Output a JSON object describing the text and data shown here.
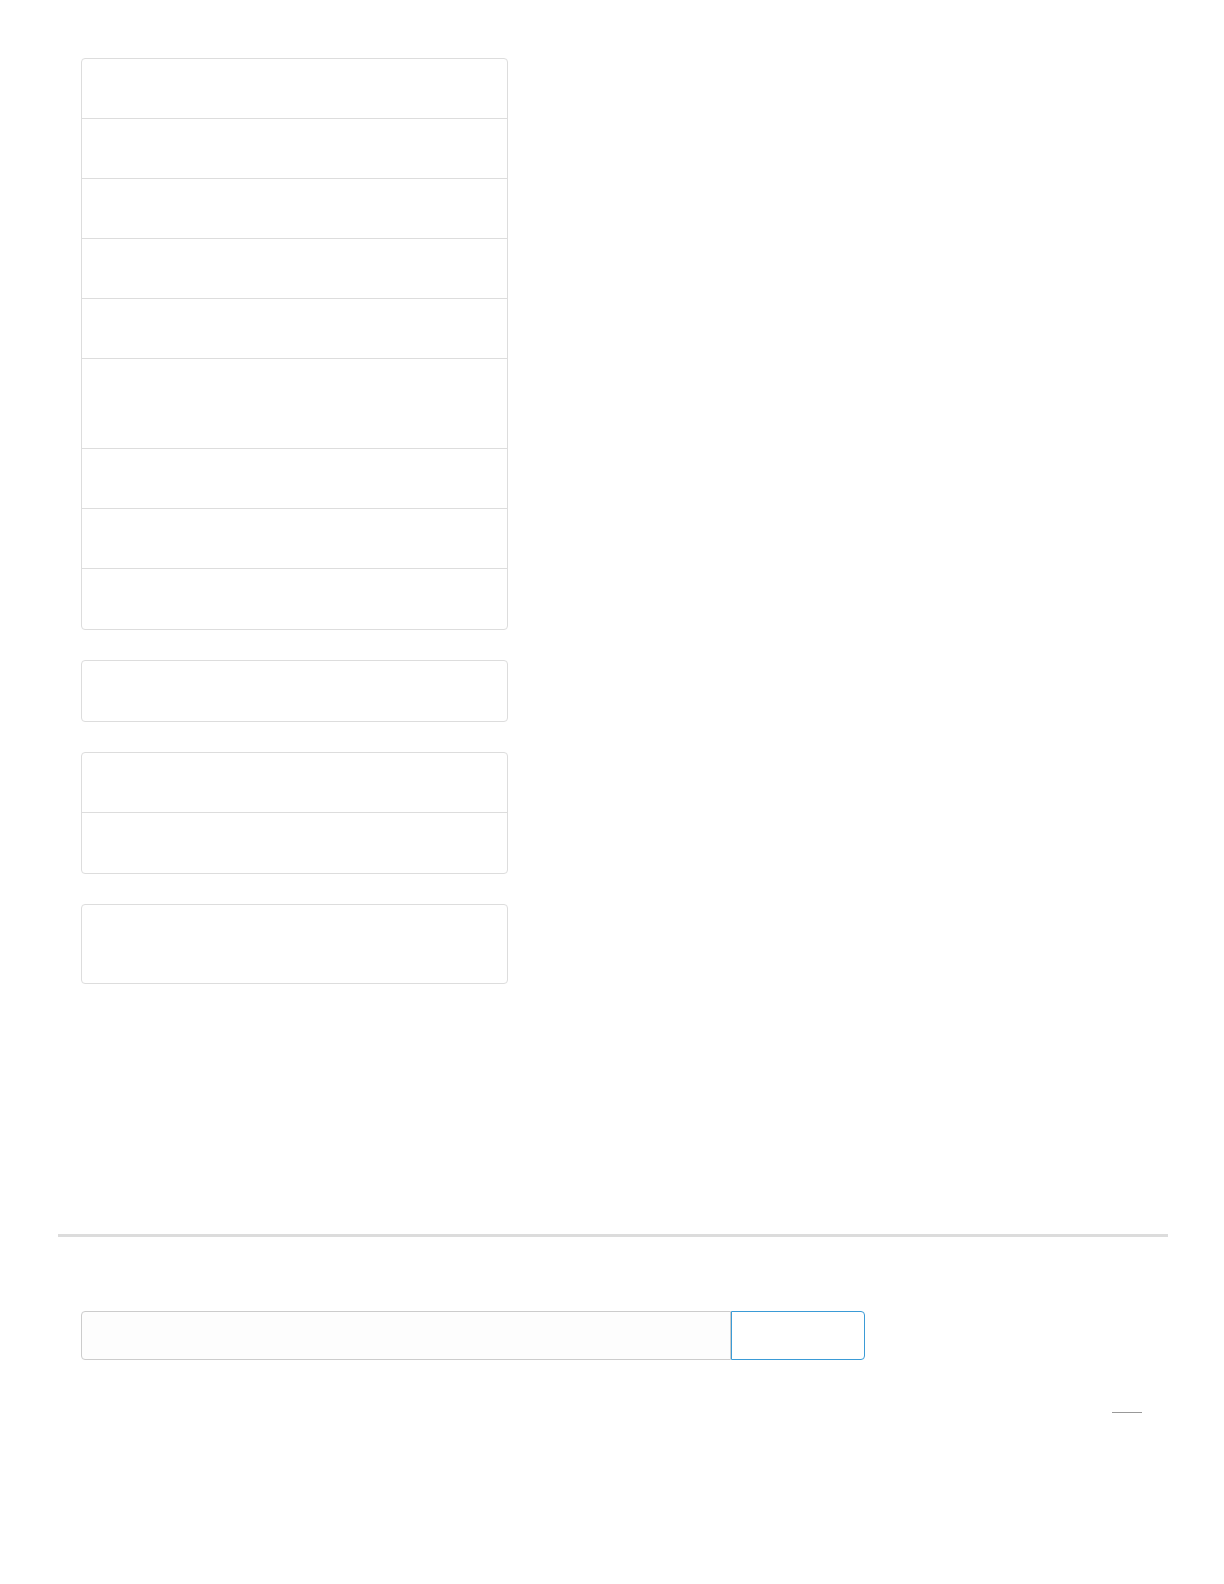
{
  "list_groups": [
    {
      "items": [
        {
          "kind": "row"
        },
        {
          "kind": "row"
        },
        {
          "kind": "row"
        },
        {
          "kind": "row"
        },
        {
          "kind": "row"
        },
        {
          "kind": "tall"
        },
        {
          "kind": "row"
        },
        {
          "kind": "row"
        },
        {
          "kind": "row"
        }
      ]
    },
    {
      "items": [
        {
          "kind": "row"
        }
      ]
    },
    {
      "items": [
        {
          "kind": "row"
        },
        {
          "kind": "row"
        }
      ]
    },
    {
      "items": [
        {
          "kind": "tall_short"
        }
      ]
    }
  ],
  "search_form": {
    "input": {
      "kind": "text"
    },
    "button": {
      "kind": "outline"
    }
  },
  "footer_link": {
    "kind": "underline"
  }
}
